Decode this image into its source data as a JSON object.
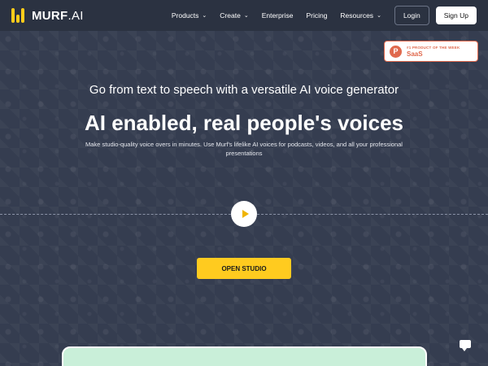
{
  "header": {
    "logo_text": "MURF",
    "logo_suffix": ".AI",
    "nav": [
      {
        "label": "Products",
        "dropdown": true
      },
      {
        "label": "Create",
        "dropdown": true
      },
      {
        "label": "Enterprise",
        "dropdown": false
      },
      {
        "label": "Pricing",
        "dropdown": false
      },
      {
        "label": "Resources",
        "dropdown": true
      }
    ],
    "login_label": "Login",
    "signup_label": "Sign Up"
  },
  "badge": {
    "small": "#1 PRODUCT OF THE WEEK",
    "big": "SaaS",
    "icon_letter": "P"
  },
  "hero": {
    "subtitle": "Go from text to speech with a versatile AI voice generator",
    "title": "AI enabled, real people's voices",
    "description": "Make studio-quality voice overs in minutes. Use Murf's lifelike AI voices for podcasts, videos, and all your professional presentations",
    "cta_label": "OPEN STUDIO"
  },
  "icons": {
    "logo": "murf-logo-icon",
    "play": "play-icon",
    "chat": "chat-icon",
    "chevron": "chevron-down-icon",
    "product_hunt": "product-hunt-icon"
  },
  "colors": {
    "background": "#323a4c",
    "header": "#2b3241",
    "accent": "#ffcb1f",
    "badge": "#e0694d",
    "card": "#c9efd9"
  }
}
